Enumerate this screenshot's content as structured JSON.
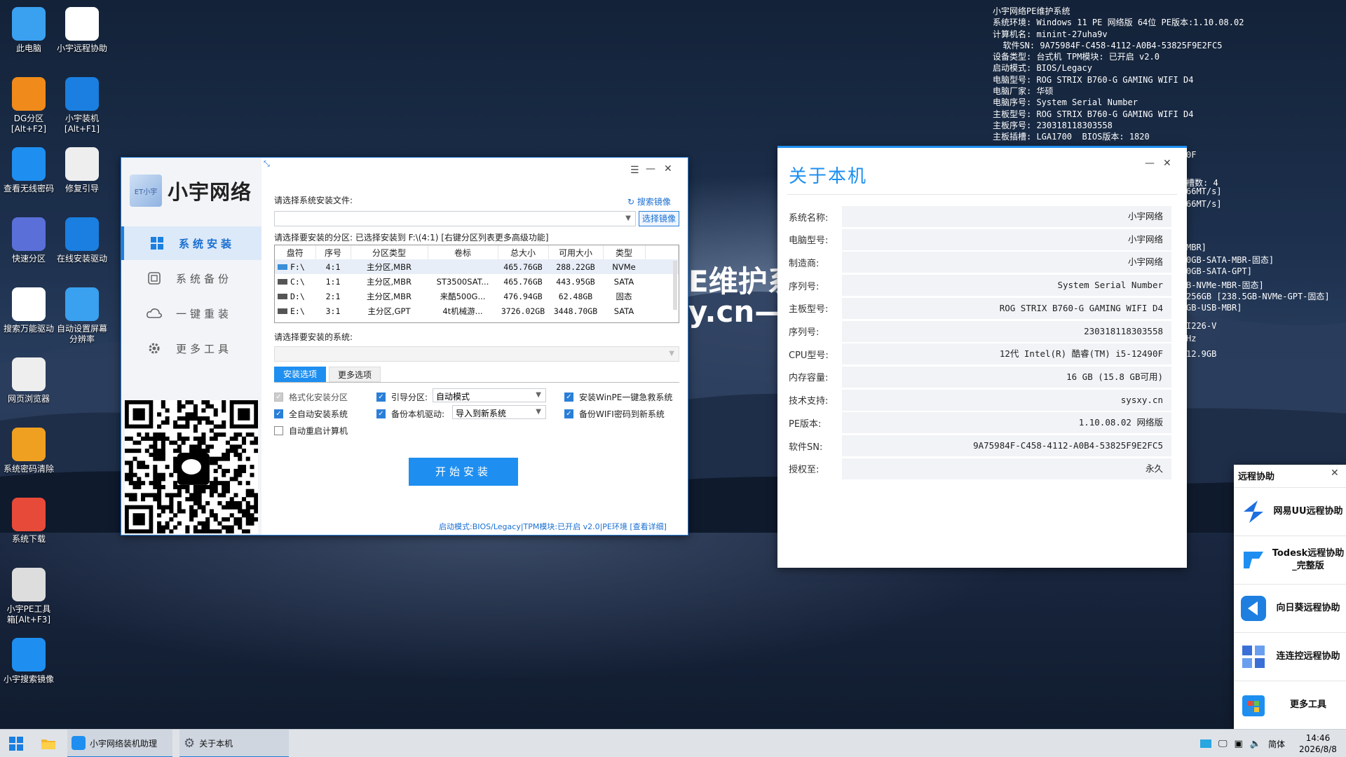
{
  "desktop": {
    "icons": [
      {
        "label": "此电脑"
      },
      {
        "label": "小宇远程协助"
      },
      {
        "label": "DG分区\n[Alt+F2]"
      },
      {
        "label": "小宇装机\n[Alt+F1]"
      },
      {
        "label": "查看无线密码"
      },
      {
        "label": "修复引导"
      },
      {
        "label": "快速分区"
      },
      {
        "label": "在线安装驱动"
      },
      {
        "label": "搜索万能驱动"
      },
      {
        "label": "自动设置屏幕\n分辨率"
      },
      {
        "label": "网页浏览器"
      },
      {
        "label": "系统密码清除"
      },
      {
        "label": "系统下载"
      },
      {
        "label": "小宇PE工具\n箱[Alt+F3]"
      },
      {
        "label": "小宇搜索镜像"
      }
    ],
    "sysinfo": [
      "小宇网络PE维护系统",
      "系统环境: Windows 11 PE 网络版 64位 PE版本:1.10.08.02",
      "计算机名: minint-27uha9v",
      "  软件SN: 9A75984F-C458-4112-A0B4-53825F9E2FC5",
      "设备类型: 台式机 TPM模块: 已开启 v2.0",
      "启动模式: BIOS/Legacy",
      "电脑型号: ROG STRIX B760-G GAMING WIFI D4",
      "电脑厂家: 华硕",
      "电脑序号: System Serial Number",
      "主板型号: ROG STRIX B760-G GAMING WIFI D4",
      "主板序号: 230318118303558",
      "主板插槽: LGA1700  BIOS版本: 1820"
    ],
    "side_fragments": [
      "0F",
      "槽数: 4",
      "66MT/s]",
      "66MT/s]",
      "MBR]",
      "0GB-SATA-MBR-固态]",
      "0GB-SATA-GPT]",
      "B-NVMe-MBR-固态]",
      "256GB [238.5GB-NVMe-GPT-固态]",
      "GB-USB-MBR]",
      "I226-V",
      "Hz",
      "12.9GB"
    ],
    "bg_text_1": "E维护系",
    "bg_text_2": "y.cn—"
  },
  "installer": {
    "brand": "小宇网络",
    "avatar_text": "ET小宇",
    "nav": [
      "系统安装",
      "系统备份",
      "一键重装",
      "更多工具"
    ],
    "file_label": "请选择系统安装文件:",
    "search_image": "搜索镜像",
    "select_image": "选择镜像",
    "partition_label": "请选择要安装的分区: 已选择安装到 F:\\(4:1) [右键分区列表更多高级功能]",
    "table_headers": [
      "盘符",
      "序号",
      "分区类型",
      "卷标",
      "总大小",
      "可用大小",
      "类型"
    ],
    "rows": [
      [
        "F:\\",
        "4:1",
        "主分区,MBR",
        "",
        "465.76GB",
        "288.22GB",
        "NVMe"
      ],
      [
        "C:\\",
        "1:1",
        "主分区,MBR",
        "ST3500SAT...",
        "465.76GB",
        "443.95GB",
        "SATA"
      ],
      [
        "D:\\",
        "2:1",
        "主分区,MBR",
        "来酷500G...",
        "476.94GB",
        "62.48GB",
        "固态"
      ],
      [
        "E:\\",
        "3:1",
        "主分区,GPT",
        "4t机械游...",
        "3726.02GB",
        "3448.70GB",
        "SATA"
      ]
    ],
    "system_label": "请选择要安装的系统:",
    "tab_install": "安装选项",
    "tab_more": "更多选项",
    "opt_format": "格式化安装分区",
    "opt_boot": "引导分区:",
    "opt_boot_value": "自动模式",
    "opt_winpe": "安装WinPE一键急救系统",
    "opt_auto": "全自动安装系统",
    "opt_driver": "备份本机驱动:",
    "opt_driver_value": "导入到新系统",
    "opt_wifi": "备份WIFI密码到新系统",
    "opt_reboot": "自动重启计算机",
    "start": "开始安装",
    "status": "启动模式:BIOS/Legacy|TPM模块:已开启 v2.0|PE环境 [查看详细]"
  },
  "about": {
    "title": "关于本机",
    "rows": [
      {
        "k": "系统名称:",
        "v": "小宇网络"
      },
      {
        "k": "电脑型号:",
        "v": "小宇网络"
      },
      {
        "k": "制造商:",
        "v": "小宇网络"
      },
      {
        "k": "序列号:",
        "v": "System Serial Number"
      },
      {
        "k": "主板型号:",
        "v": "ROG STRIX B760-G GAMING WIFI D4"
      },
      {
        "k": "序列号:",
        "v": "230318118303558"
      },
      {
        "k": "CPU型号:",
        "v": "12代 Intel(R) 酷睿(TM) i5-12490F"
      },
      {
        "k": "内存容量:",
        "v": "16 GB (15.8 GB可用)"
      },
      {
        "k": "技术支持:",
        "v": "sysxy.cn"
      },
      {
        "k": "PE版本:",
        "v": "1.10.08.02 网络版"
      },
      {
        "k": "软件SN:",
        "v": "9A75984F-C458-4112-A0B4-53825F9E2FC5"
      },
      {
        "k": "授权至:",
        "v": "永久"
      }
    ]
  },
  "remote": {
    "title": "远程协助",
    "items": [
      "网易UU远程协助",
      "Todesk远程协助_完整版",
      "向日葵远程协助",
      "连连控远程协助",
      "更多工具"
    ]
  },
  "taskbar": {
    "app1": "小宇网络装机助理",
    "app2": "关于本机",
    "ime": "简体",
    "time": "14:46",
    "date": "2026/8/8"
  }
}
